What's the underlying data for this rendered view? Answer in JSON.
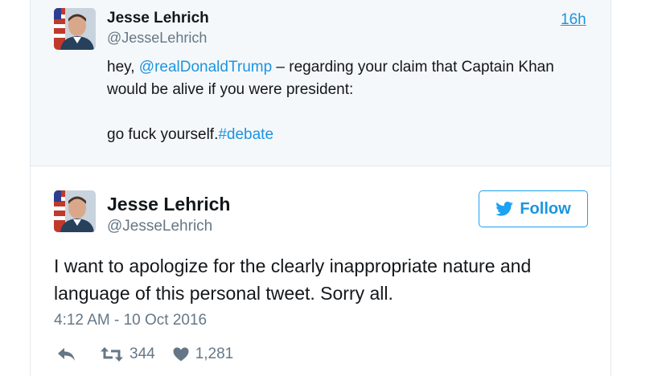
{
  "quoted_tweet": {
    "author_name": "Jesse Lehrich",
    "author_handle": "@JesseLehrich",
    "time": "16h",
    "text_before": "hey, ",
    "mention": "@realDonaldTrump",
    "text_middle": " – regarding your claim that Captain Khan would be alive if you were president:\n\ngo fuck yourself.",
    "hashtag": "#debate"
  },
  "main_tweet": {
    "author_name": "Jesse Lehrich",
    "author_handle": "@JesseLehrich",
    "follow_label": "Follow",
    "text": "I want to apologize for the clearly inappropriate nature and language of this personal tweet. Sorry all.",
    "timestamp": "4:12 AM - 10 Oct 2016",
    "retweet_count": "344",
    "like_count": "1,281"
  },
  "colors": {
    "link": "#1b95e0",
    "secondary_text": "#657786",
    "quoted_background": "#f5f8fa"
  },
  "icons": [
    "avatar",
    "twitter-bird-icon",
    "reply-icon",
    "retweet-icon",
    "heart-icon"
  ]
}
